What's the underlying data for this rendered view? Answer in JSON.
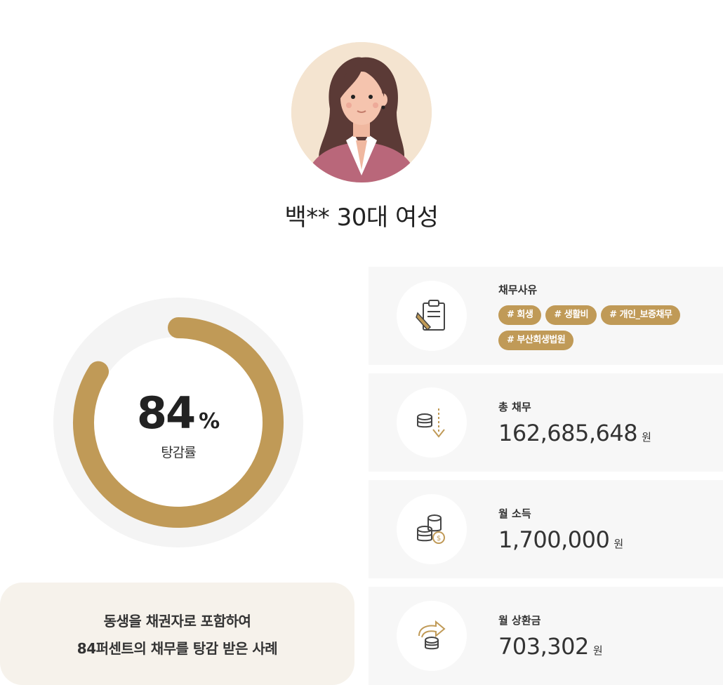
{
  "profile": {
    "name": "백** 30대 여성"
  },
  "gauge": {
    "percent": 84,
    "value_text": "84",
    "unit": "%",
    "label": "탕감률",
    "color": "#c09a57",
    "track_color": "#f4f4f4"
  },
  "summary": {
    "line1": "동생을 채권자로 포함하여",
    "line2": "84퍼센트의 채무를 탕감 받은 사례"
  },
  "cards": [
    {
      "icon": "clipboard-icon",
      "title": "채무사유",
      "tags": [
        "# 회생",
        "# 생활비",
        "# 개인_보증채무",
        "# 부산회생법원"
      ]
    },
    {
      "icon": "coins-down-arrow-icon",
      "title": "총 채무",
      "value": "162,685,648",
      "unit": "원"
    },
    {
      "icon": "coins-stack-icon",
      "title": "월 소득",
      "value": "1,700,000",
      "unit": "원"
    },
    {
      "icon": "coins-return-arrow-icon",
      "title": "월 상환금",
      "value": "703,302",
      "unit": "원"
    }
  ],
  "colors": {
    "accent": "#c09a57",
    "card_bg": "#f7f7f7",
    "summary_bg": "#f6f2eb"
  }
}
